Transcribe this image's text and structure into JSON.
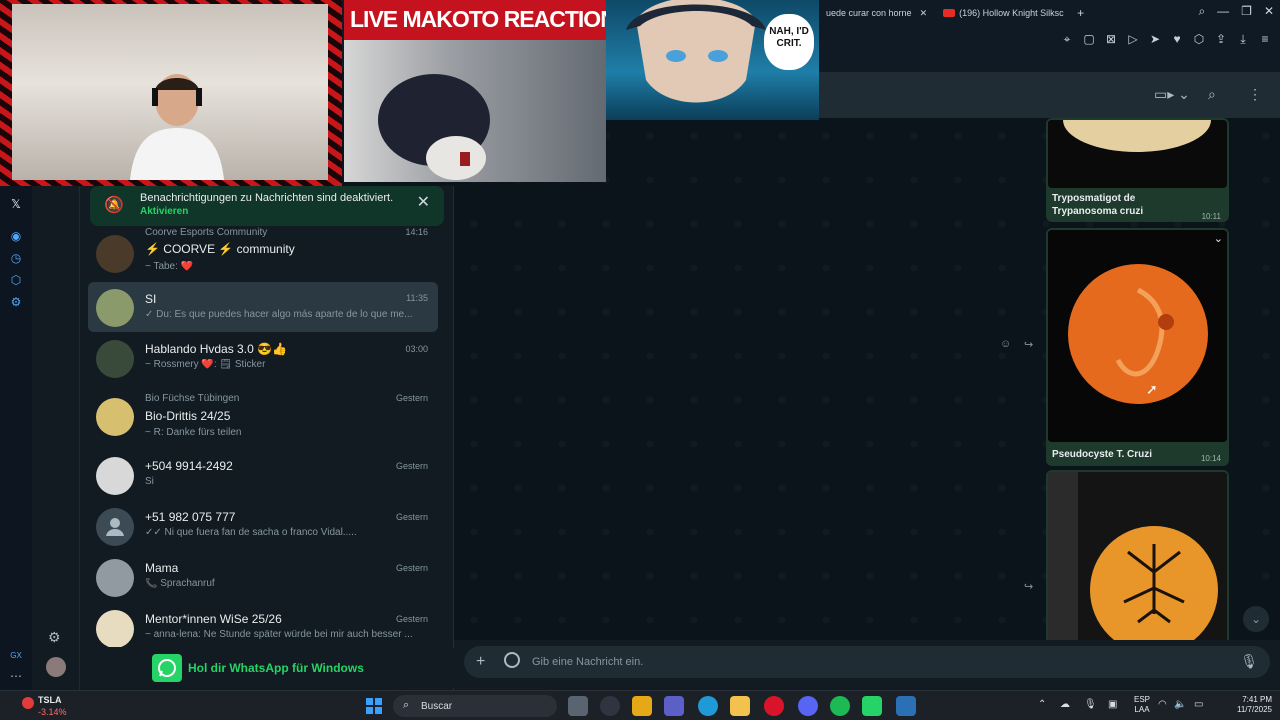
{
  "browser": {
    "tabs": [
      {
        "label": "uede curar con horne"
      },
      {
        "label": "(196) Hollow Knight Silksc"
      }
    ],
    "new_tab": "+"
  },
  "overlay": {
    "reaction_banner": "LIVE MAKOTO REACTION",
    "speech_bubble": "NAH, I'D CRIT."
  },
  "notification": {
    "title": "Benachrichtigungen zu Nachrichten sind deaktiviert.",
    "action": "Aktivieren"
  },
  "chats": [
    {
      "group": "Coorve Esports Community",
      "name": "⚡ COORVE ⚡ community",
      "preview": "~ Tabe: ❤️",
      "time": "14:16"
    },
    {
      "name": "SI",
      "preview": "✓ Du: Es que puedes hacer algo más aparte de lo que me...",
      "time": "11:35"
    },
    {
      "name": "Hablando Hvdas 3.0 😎👍",
      "preview": "~ Rossmery ❤️: 🗒 Sticker",
      "time": "03:00"
    },
    {
      "group": "Bio Füchse Tübingen",
      "name": "Bio-Drittis 24/25",
      "preview": "~ R: Danke fürs teilen",
      "time": "Gestern"
    },
    {
      "name": "+504 9914-2492",
      "preview": "Si",
      "time": "Gestern"
    },
    {
      "name": "+51 982 075 777",
      "preview": "✓✓ Ni que fuera fan de sacha o franco Vidal.....",
      "time": "Gestern"
    },
    {
      "name": "Mama",
      "preview": "📞 Sprachanruf",
      "time": "Gestern"
    },
    {
      "name": "Mentor*innen WiSe 25/26",
      "preview": "~ anna-lena: Ne Stunde später würde bei mir auch besser ...",
      "time": "Gestern"
    }
  ],
  "get_whatsapp": "Hol dir WhatsApp für Windows",
  "messages": [
    {
      "caption": "Tryposmatigot de Trypanosoma cruzi",
      "time": "10:11"
    },
    {
      "caption": "Pseudocyste T. Cruzi",
      "time": "10:14"
    },
    {
      "caption": "",
      "time": ""
    }
  ],
  "composer": {
    "placeholder": "Gib eine Nachricht ein."
  },
  "taskbar": {
    "ticker_symbol": "TSLA",
    "ticker_change": "-3.14%",
    "search": "Buscar",
    "lang_1": "ESP",
    "lang_2": "LAA",
    "time": "7:41 PM",
    "date": "11/7/2025"
  },
  "opera": {
    "gx": "GX"
  },
  "colors": {
    "accent": "#25d366",
    "outgoing_bubble": "#1e3a2c",
    "panel": "#111b21"
  }
}
